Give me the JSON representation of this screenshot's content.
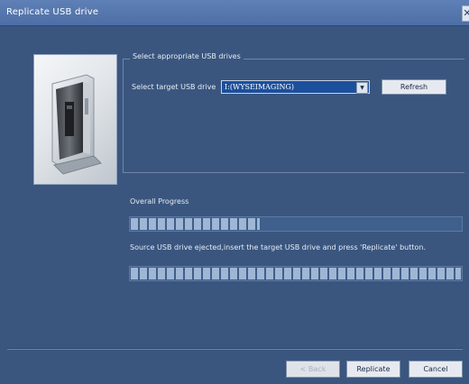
{
  "window": {
    "title": "Replicate USB drive"
  },
  "group": {
    "legend": "Select appropriate USB drives",
    "target_label": "Select target USB drive",
    "target_value": "I:(WYSEIMAGING)",
    "refresh_label": "Refresh"
  },
  "progress": {
    "overall_label": "Overall Progress",
    "overall_value": 0.39,
    "status_text": "Source USB drive ejected,insert the target USB drive and press 'Replicate' button.",
    "usb_value": 1.0
  },
  "footer": {
    "back_label": "< Back",
    "replicate_label": "Replicate",
    "cancel_label": "Cancel"
  },
  "icons": {
    "close": "close-icon",
    "dropdown": "chevron-down-icon",
    "device": "thin-client-device-image"
  },
  "colors": {
    "window_bg": "#3a567f",
    "titlebar": "#5e80b6",
    "progress_fill": "#9fb6d4",
    "select_bg": "#1c4f9c"
  }
}
